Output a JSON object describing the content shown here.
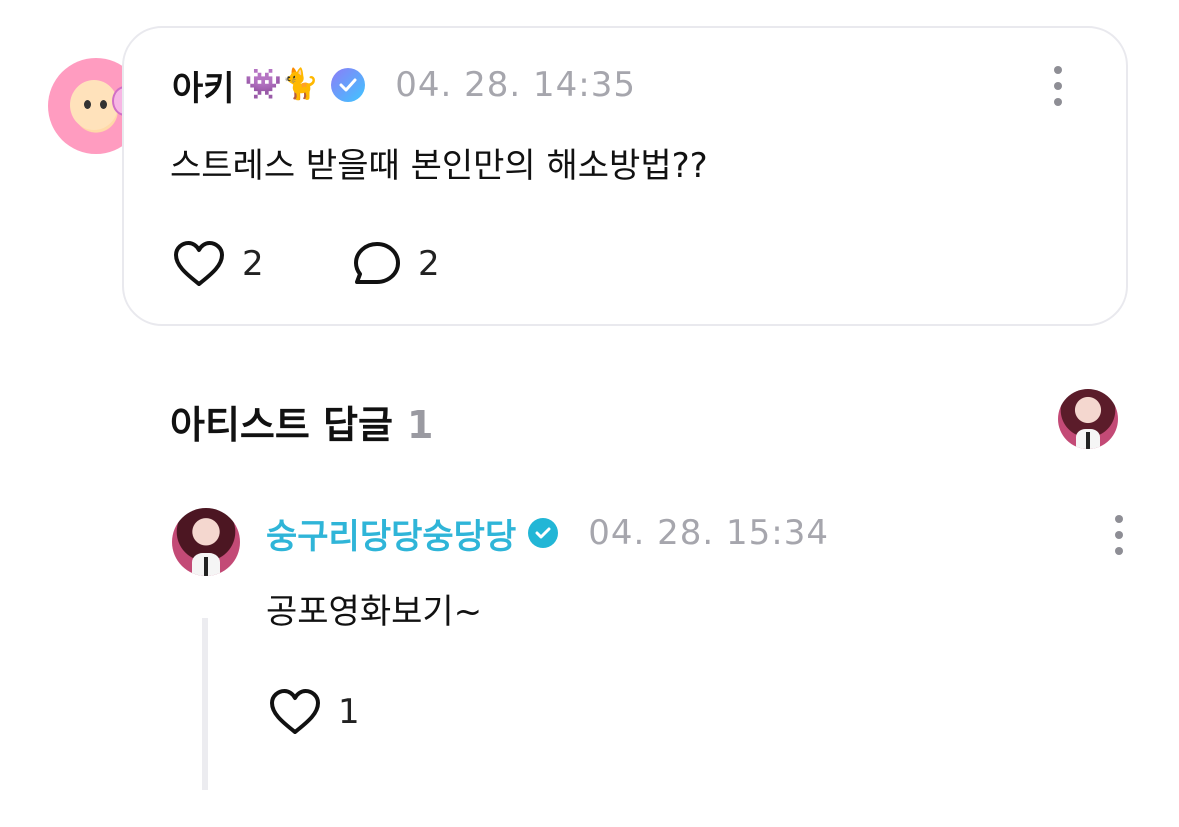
{
  "post": {
    "author": "아키",
    "author_emojis": "👾🐈",
    "timestamp": "04. 28. 14:35",
    "text": "스트레스 받을때 본인만의 해소방법??",
    "like_count": "2",
    "reply_count": "2"
  },
  "section": {
    "title": "아티스트 답글",
    "count": "1"
  },
  "reply": {
    "author": "숭구리당당숭당당",
    "timestamp": "04. 28. 15:34",
    "text": "공포영화보기~",
    "like_count": "1"
  },
  "colors": {
    "artist_name": "#2fb5d8",
    "timestamp": "#a6a6ad",
    "card_border": "#e9e9ee"
  },
  "icons": {
    "like": "heart-outline-icon",
    "reply": "speech-bubble-icon",
    "more": "kebab-menu-icon",
    "verified": "verified-badge-icon"
  }
}
